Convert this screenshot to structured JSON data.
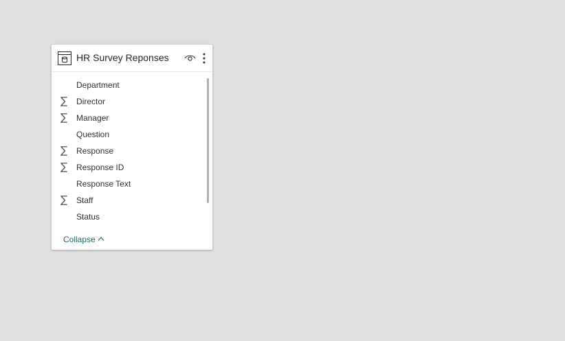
{
  "table_card": {
    "title": "HR Survey Reponses",
    "icon": "table-icon",
    "visibility_icon": "eye-icon",
    "more_icon": "more-options-icon",
    "fields": [
      {
        "label": "Department",
        "aggregate": false
      },
      {
        "label": "Director",
        "aggregate": true
      },
      {
        "label": "Manager",
        "aggregate": true
      },
      {
        "label": "Question",
        "aggregate": false
      },
      {
        "label": "Response",
        "aggregate": true
      },
      {
        "label": "Response ID",
        "aggregate": true
      },
      {
        "label": "Response Text",
        "aggregate": false
      },
      {
        "label": "Staff",
        "aggregate": true
      },
      {
        "label": "Status",
        "aggregate": false
      }
    ],
    "sigma_symbol": "∑",
    "collapse_label": "Collapse"
  },
  "colors": {
    "canvas_background": "#e1e0df",
    "card_background": "#ffffff",
    "collapse_link": "#10736b",
    "scrollbar_thumb": "#b3b0ad"
  }
}
